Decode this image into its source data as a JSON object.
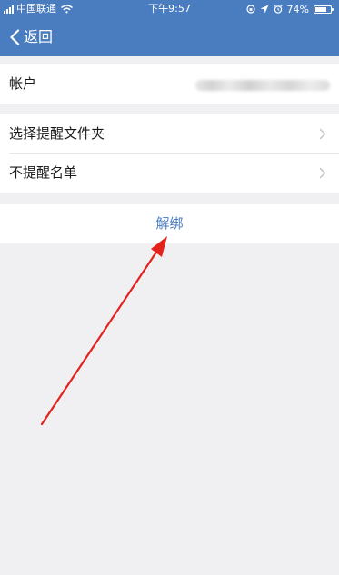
{
  "status_bar": {
    "carrier": "中国联通",
    "time": "下午9:57",
    "battery_percent": "74%",
    "battery_level": 0.74
  },
  "nav": {
    "back_label": "返回"
  },
  "account": {
    "label": "帐户"
  },
  "settings": {
    "items": [
      {
        "label": "选择提醒文件夹"
      },
      {
        "label": "不提醒名单"
      }
    ]
  },
  "actions": {
    "unbind_label": "解绑"
  },
  "colors": {
    "header_bg": "#4a7cc0",
    "page_bg": "#f0f0f2",
    "link_blue": "#4a7cc0",
    "annotation_red": "#e3221c"
  },
  "icons": [
    "signal-icon",
    "wifi-icon",
    "location-icon",
    "alarm-icon",
    "battery-icon",
    "back-chevron-icon",
    "chevron-right-icon"
  ]
}
